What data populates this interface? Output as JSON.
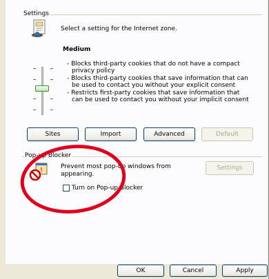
{
  "settings": {
    "group_title": "Settings",
    "instruction": "Select a setting for the Internet zone.",
    "level": "Medium",
    "descriptions": [
      "- Blocks third-party cookies that do not have a compact",
      "privacy policy",
      "- Blocks third-party cookies that save information that can",
      "be used to contact you without your explicit consent",
      "- Restricts first-party cookies that save information that",
      "can be used to contact you without your implicit consent"
    ],
    "buttons": {
      "sites": "Sites",
      "import": "Import",
      "advanced": "Advanced",
      "default": "Default"
    }
  },
  "popup": {
    "group_title": "Pop-up Blocker",
    "description_line1": "Prevent most pop-up windows from",
    "description_line2": "appearing.",
    "settings_button": "Settings",
    "checkbox_label": "Turn on Pop-up Blocker",
    "checkbox_checked": false
  },
  "footer": {
    "ok": "OK",
    "cancel": "Cancel",
    "apply": "Apply"
  },
  "annotation": {
    "ellipse_color": "#e0001b"
  },
  "icons": {
    "settings": "internet-zone-icon",
    "popup": "popup-blocked-icon"
  }
}
